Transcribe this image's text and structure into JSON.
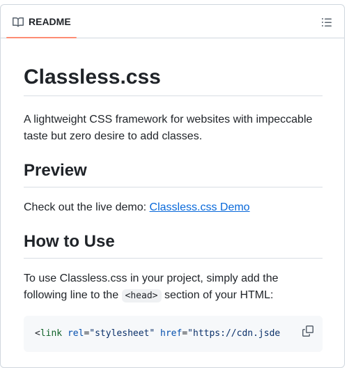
{
  "header": {
    "tab_label": "README",
    "tab_icon": "book-icon",
    "outline_icon": "list-unordered-icon",
    "accent": "#fd8c73"
  },
  "readme": {
    "title": "Classless.css",
    "intro": "A lightweight CSS framework for websites with impeccable taste but zero desire to add classes.",
    "preview_heading": "Preview",
    "preview_text": "Check out the live demo: ",
    "preview_link": "Classless.css Demo",
    "howto_heading": "How to Use",
    "howto_text_before": "To use Classless.css in your project, simply add the following line to the ",
    "howto_code": "<head>",
    "howto_text_after": " section of your HTML:",
    "code": {
      "open": "<",
      "tag": "link",
      "attr1": "rel",
      "eq1": "=",
      "val1": "\"stylesheet\"",
      "attr2": "href",
      "eq2": "=",
      "val2": "\"https://cdn.jsde"
    },
    "copy_icon": "copy-icon"
  }
}
